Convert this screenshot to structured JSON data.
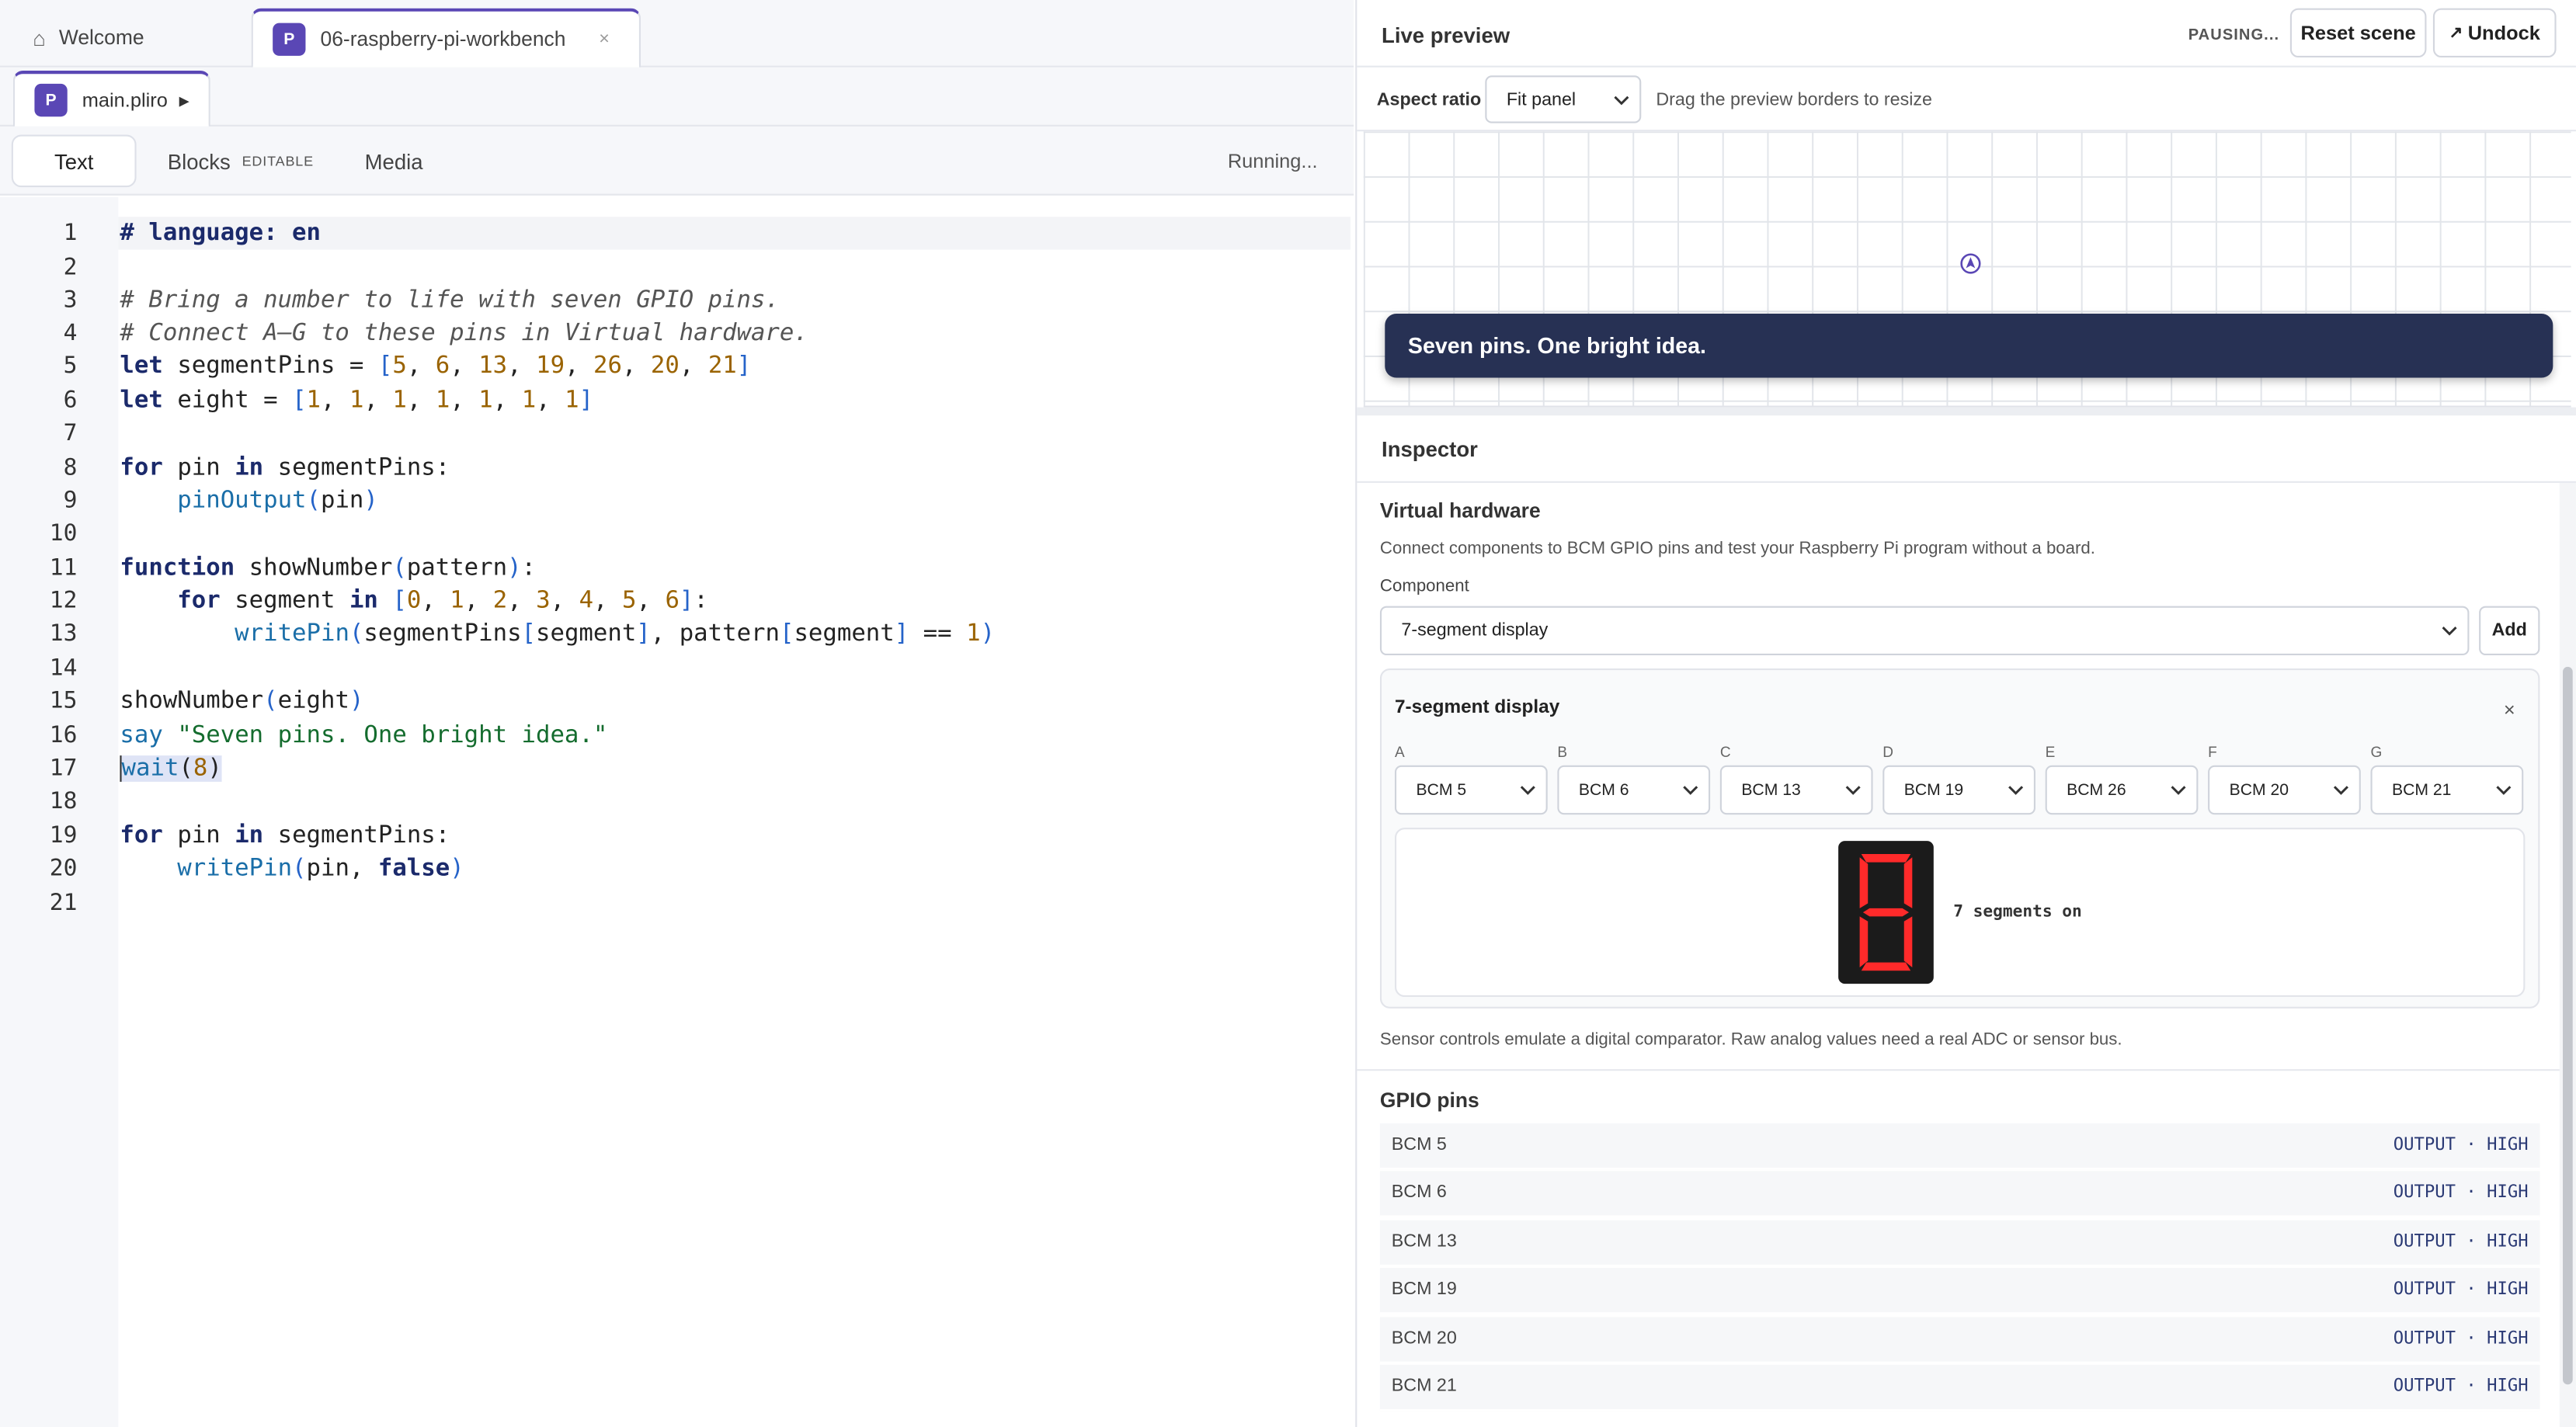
{
  "tabs": [
    {
      "label": "Welcome",
      "icon": "home-icon"
    },
    {
      "label": "06-raspberry-pi-workbench",
      "badge": "P",
      "close": "×"
    }
  ],
  "file": {
    "badge": "P",
    "name": "main.pliro",
    "run_glyph": "▶"
  },
  "modes": {
    "text": "Text",
    "blocks": "Blocks",
    "blocks_tag": "EDITABLE",
    "media": "Media",
    "status": "Running..."
  },
  "code": {
    "line_numbers": [
      "1",
      "2",
      "3",
      "4",
      "5",
      "6",
      "7",
      "8",
      "9",
      "10",
      "11",
      "12",
      "13",
      "14",
      "15",
      "16",
      "17",
      "18",
      "19",
      "20",
      "21"
    ],
    "lines": [
      "# language: en",
      "",
      "# Bring a number to life with seven GPIO pins.",
      "# Connect A–G to these pins in Virtual hardware.",
      "let segmentPins = [5, 6, 13, 19, 26, 20, 21]",
      "let eight = [1, 1, 1, 1, 1, 1, 1]",
      "",
      "for pin in segmentPins:",
      "    pinOutput(pin)",
      "",
      "function showNumber(pattern):",
      "    for segment in [0, 1, 2, 3, 4, 5, 6]:",
      "        writePin(segmentPins[segment], pattern[segment] == 1)",
      "",
      "showNumber(eight)",
      "say \"Seven pins. One bright idea.\"",
      "wait(8)",
      "",
      "for pin in segmentPins:",
      "    writePin(pin, false)",
      ""
    ]
  },
  "preview": {
    "title": "Live preview",
    "status": "PAUSING...",
    "reset_label": "Reset scene",
    "undock_label": "Undock",
    "undock_glyph": "↗",
    "aspect_label": "Aspect ratio",
    "aspect_value": "Fit panel",
    "hint": "Drag the preview borders to resize",
    "speech": "Seven pins. One bright idea."
  },
  "inspector": {
    "title": "Inspector",
    "vh_title": "Virtual hardware",
    "vh_desc": "Connect components to BCM GPIO pins and test your Raspberry Pi program without a board.",
    "component_label": "Component",
    "component_value": "7-segment display",
    "add_label": "Add",
    "card_title": "7-segment display",
    "card_close": "×",
    "pins": [
      {
        "label": "A",
        "value": "BCM 5"
      },
      {
        "label": "B",
        "value": "BCM 6"
      },
      {
        "label": "C",
        "value": "BCM 13"
      },
      {
        "label": "D",
        "value": "BCM 19"
      },
      {
        "label": "E",
        "value": "BCM 26"
      },
      {
        "label": "F",
        "value": "BCM 20"
      },
      {
        "label": "G",
        "value": "BCM 21"
      }
    ],
    "segments_text": "7 segments on",
    "segment_color": "#ff2a2a",
    "sensor_note": "Sensor controls emulate a digital comparator. Raw analog values need a real ADC or sensor bus.",
    "gpio_title": "GPIO pins",
    "gpio": [
      {
        "name": "BCM 5",
        "state": "OUTPUT · HIGH"
      },
      {
        "name": "BCM 6",
        "state": "OUTPUT · HIGH"
      },
      {
        "name": "BCM 13",
        "state": "OUTPUT · HIGH"
      },
      {
        "name": "BCM 19",
        "state": "OUTPUT · HIGH"
      },
      {
        "name": "BCM 20",
        "state": "OUTPUT · HIGH"
      },
      {
        "name": "BCM 21",
        "state": "OUTPUT · HIGH"
      }
    ]
  },
  "colors": {
    "accent": "#5a47b5",
    "speech_bg": "#273154"
  }
}
